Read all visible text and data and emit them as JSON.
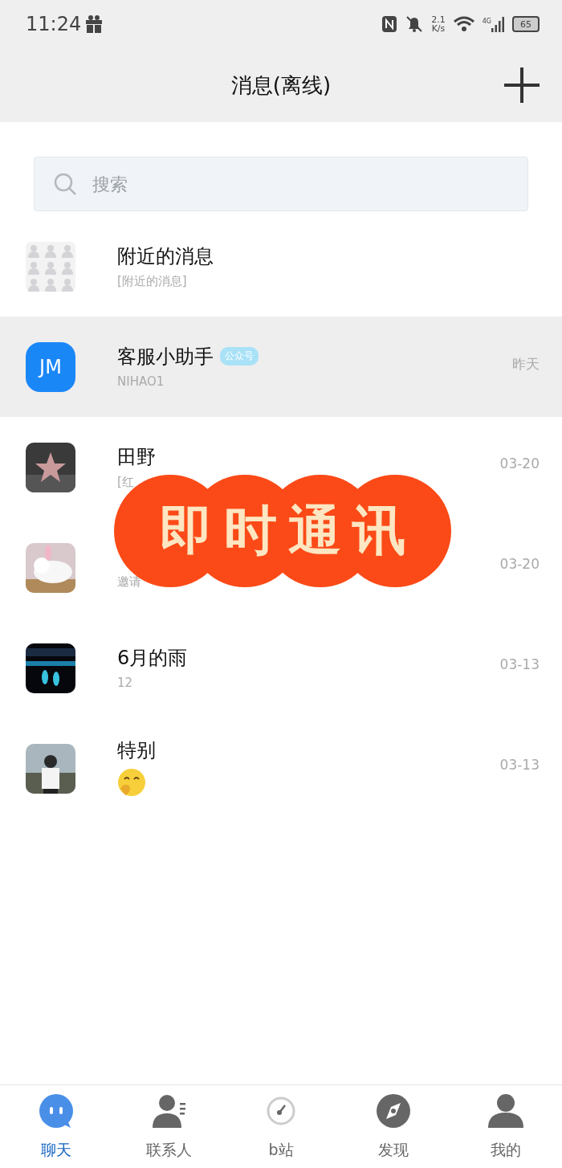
{
  "status_bar": {
    "time": "11:24",
    "speed": "2.1",
    "speed_unit": "K/s",
    "network": "4G",
    "battery": "65"
  },
  "header": {
    "title": "消息(离线)"
  },
  "search": {
    "placeholder": "搜索"
  },
  "chats": [
    {
      "kind": "nearby",
      "selected": false,
      "name": "附近的消息",
      "preview": "[附近的消息]"
    },
    {
      "kind": "account",
      "initials": "JM",
      "selected": true,
      "name": "客服小助手",
      "badge": "公众号",
      "preview": "NIHAO1",
      "time": "昨天"
    },
    {
      "kind": "contact",
      "selected": false,
      "name": "田野",
      "preview": "[红",
      "time": "03-20"
    },
    {
      "kind": "contact",
      "selected": false,
      "preview": "邀请",
      "time": "03-20"
    },
    {
      "kind": "contact",
      "selected": false,
      "name": "6月的雨",
      "preview": "12",
      "time": "03-13"
    },
    {
      "kind": "sticker",
      "selected": false,
      "name": "特别",
      "time": "03-13"
    }
  ],
  "overlay": {
    "text": "即时通讯"
  },
  "tabs": [
    {
      "label": "聊天",
      "selected": true
    },
    {
      "label": "联系人",
      "selected": false
    },
    {
      "label": "b站",
      "selected": false
    },
    {
      "label": "发现",
      "selected": false
    },
    {
      "label": "我的",
      "selected": false
    }
  ]
}
